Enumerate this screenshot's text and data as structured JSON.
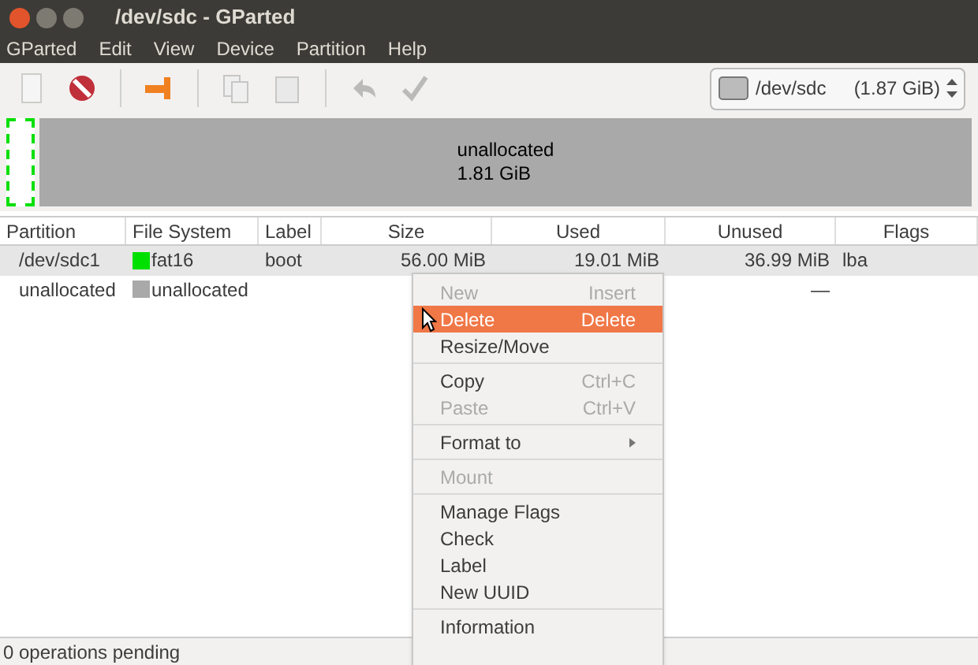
{
  "window": {
    "title": "/dev/sdc - GParted"
  },
  "menubar": [
    "GParted",
    "Edit",
    "View",
    "Device",
    "Partition",
    "Help"
  ],
  "toolbar": [
    {
      "kind": "new",
      "disabled": true
    },
    {
      "kind": "delete",
      "disabled": false
    },
    {
      "kind": "sep"
    },
    {
      "kind": "resize",
      "disabled": false
    },
    {
      "kind": "sep"
    },
    {
      "kind": "copy",
      "disabled": true
    },
    {
      "kind": "paste",
      "disabled": true
    },
    {
      "kind": "sep"
    },
    {
      "kind": "undo",
      "disabled": true
    },
    {
      "kind": "apply",
      "disabled": true
    }
  ],
  "device": {
    "name": "/dev/sdc",
    "size": "(1.87 GiB)"
  },
  "disk_map": {
    "label": "unallocated",
    "size": "1.81 GiB"
  },
  "table": {
    "columns": [
      "Partition",
      "File System",
      "Label",
      "Size",
      "Used",
      "Unused",
      "Flags"
    ],
    "rows": [
      {
        "selected": true,
        "partition": "/dev/sdc1",
        "fs": "fat16",
        "color": "#00e000",
        "label": "boot",
        "size": "56.00 MiB",
        "used": "19.01 MiB",
        "unused": "36.99 MiB",
        "flags": "lba"
      },
      {
        "selected": false,
        "partition": "unallocated",
        "fs": "unallocated",
        "color": "#a9a9a9",
        "label": "",
        "size": "",
        "used": "",
        "unused": "—",
        "flags": ""
      }
    ]
  },
  "context_menu": [
    {
      "kind": "item",
      "label": "New",
      "shortcut": "Insert",
      "disabled": true,
      "selected": false
    },
    {
      "kind": "item",
      "label": "Delete",
      "shortcut": "Delete",
      "disabled": false,
      "selected": true
    },
    {
      "kind": "item",
      "label": "Resize/Move",
      "disabled": false,
      "selected": false
    },
    {
      "kind": "separator"
    },
    {
      "kind": "item",
      "label": "Copy",
      "shortcut": "Ctrl+C",
      "disabled": false,
      "selected": false
    },
    {
      "kind": "item",
      "label": "Paste",
      "shortcut": "Ctrl+V",
      "disabled": true,
      "selected": false
    },
    {
      "kind": "separator"
    },
    {
      "kind": "item",
      "label": "Format to",
      "submenu": true,
      "disabled": false,
      "selected": false
    },
    {
      "kind": "separator"
    },
    {
      "kind": "item",
      "label": "Mount",
      "disabled": true,
      "selected": false
    },
    {
      "kind": "separator"
    },
    {
      "kind": "item",
      "label": "Manage Flags",
      "disabled": false,
      "selected": false
    },
    {
      "kind": "item",
      "label": "Check",
      "disabled": false,
      "selected": false
    },
    {
      "kind": "item",
      "label": "Label",
      "disabled": false,
      "selected": false
    },
    {
      "kind": "item",
      "label": "New UUID",
      "disabled": false,
      "selected": false
    },
    {
      "kind": "separator"
    },
    {
      "kind": "item",
      "label": "Information",
      "disabled": false,
      "selected": false
    }
  ],
  "status_bar": "0 operations pending"
}
